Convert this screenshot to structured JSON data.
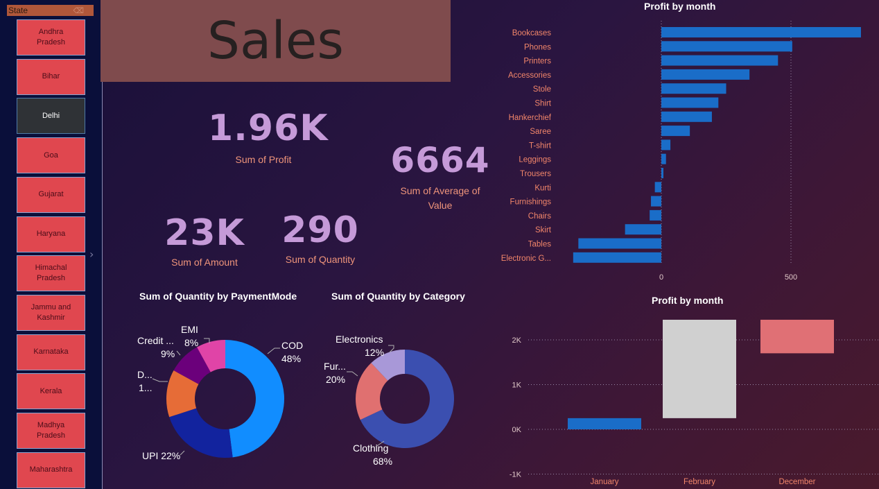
{
  "slicer": {
    "header": "State",
    "erase_icon": "eraser-icon",
    "items": [
      {
        "label": "Andhra Pradesh",
        "selected": false
      },
      {
        "label": "Bihar",
        "selected": false
      },
      {
        "label": "Delhi",
        "selected": true
      },
      {
        "label": "Goa",
        "selected": false
      },
      {
        "label": "Gujarat",
        "selected": false
      },
      {
        "label": "Haryana",
        "selected": false
      },
      {
        "label": "Himachal Pradesh",
        "selected": false
      },
      {
        "label": "Jammu and Kashmir",
        "selected": false
      },
      {
        "label": "Karnataka",
        "selected": false
      },
      {
        "label": "Kerala",
        "selected": false
      },
      {
        "label": "Madhya Pradesh",
        "selected": false
      },
      {
        "label": "Maharashtra",
        "selected": false
      }
    ],
    "expander": "›"
  },
  "title": "Sales",
  "kpis": {
    "profit": {
      "value": "1.96K",
      "label": "Sum of Profit"
    },
    "average_value": {
      "value": "6664",
      "label": "Sum of Average of Value"
    },
    "amount": {
      "value": "23K",
      "label": "Sum of Amount"
    },
    "quantity": {
      "value": "290",
      "label": "Sum of Quantity"
    }
  },
  "colors": {
    "bar_blue": "#1a6dc8",
    "pie_cod": "#118dff",
    "pie_upi": "#12239e",
    "pie_d": "#e66c37",
    "pie_credit": "#6b007b",
    "pie_emi": "#e044a7",
    "cat_clothing": "#3b4fb0",
    "cat_furniture": "#e07070",
    "cat_electronics": "#a898d8",
    "waterfall_increase": "#d0d0d0",
    "waterfall_decrease": "#e07075",
    "waterfall_first": "#1a6dc8"
  },
  "chart_data": [
    {
      "type": "bar",
      "orientation": "horizontal",
      "title": "Profit by month",
      "categories": [
        "Bookcases",
        "Phones",
        "Printers",
        "Accessories",
        "Stole",
        "Shirt",
        "Hankerchief",
        "Saree",
        "T-shirt",
        "Leggings",
        "Trousers",
        "Kurti",
        "Furnishings",
        "Chairs",
        "Skirt",
        "Tables",
        "Electronic G..."
      ],
      "values": [
        770,
        505,
        450,
        340,
        250,
        220,
        195,
        110,
        35,
        18,
        8,
        -25,
        -40,
        -45,
        -140,
        -320,
        -340
      ],
      "xlim": [
        -340,
        770
      ],
      "ticks": [
        0,
        500
      ],
      "grid": true
    },
    {
      "type": "donut",
      "title": "Sum of Quantity by PaymentMode",
      "slices": [
        {
          "name": "COD",
          "pct": 48,
          "label": "COD",
          "pct_label": "48%"
        },
        {
          "name": "UPI",
          "pct": 22,
          "label": "UPI 22%",
          "pct_label": ""
        },
        {
          "name": "D...",
          "pct": 13,
          "label": "D...",
          "pct_label": "1..."
        },
        {
          "name": "Credit ...",
          "pct": 9,
          "label": "Credit ...",
          "pct_label": "9%"
        },
        {
          "name": "EMI",
          "pct": 8,
          "label": "EMI",
          "pct_label": "8%"
        }
      ]
    },
    {
      "type": "donut",
      "title": "Sum of Quantity by Category",
      "slices": [
        {
          "name": "Clothing",
          "pct": 68,
          "label": "Clothing",
          "pct_label": "68%"
        },
        {
          "name": "Fur...",
          "pct": 20,
          "label": "Fur...",
          "pct_label": "20%"
        },
        {
          "name": "Electronics",
          "pct": 12,
          "label": "Electronics",
          "pct_label": "12%"
        }
      ]
    },
    {
      "type": "waterfall",
      "title": "Profit by month",
      "categories": [
        "January",
        "February",
        "December"
      ],
      "deltas": [
        250,
        2200,
        -750
      ],
      "ylim": [
        -1000,
        2400
      ],
      "ticks": [
        -1000,
        0,
        1000,
        2000
      ],
      "tick_labels": [
        "-1K",
        "0K",
        "1K",
        "2K"
      ],
      "grid": true
    }
  ]
}
